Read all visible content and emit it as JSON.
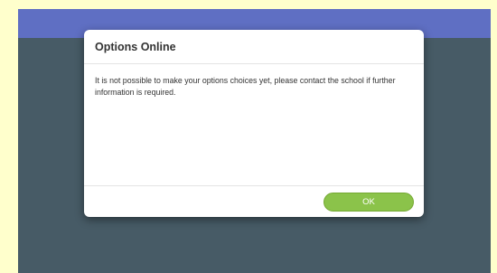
{
  "modal": {
    "title": "Options Online",
    "message": "It is not possible to make your options choices yet, please contact the school if further information is required.",
    "ok_label": "OK"
  },
  "colors": {
    "page_background": "#ffffcc",
    "top_bar": "#5f6fc3",
    "overlay": "#475b66",
    "ok_button": "#8bc34a"
  }
}
